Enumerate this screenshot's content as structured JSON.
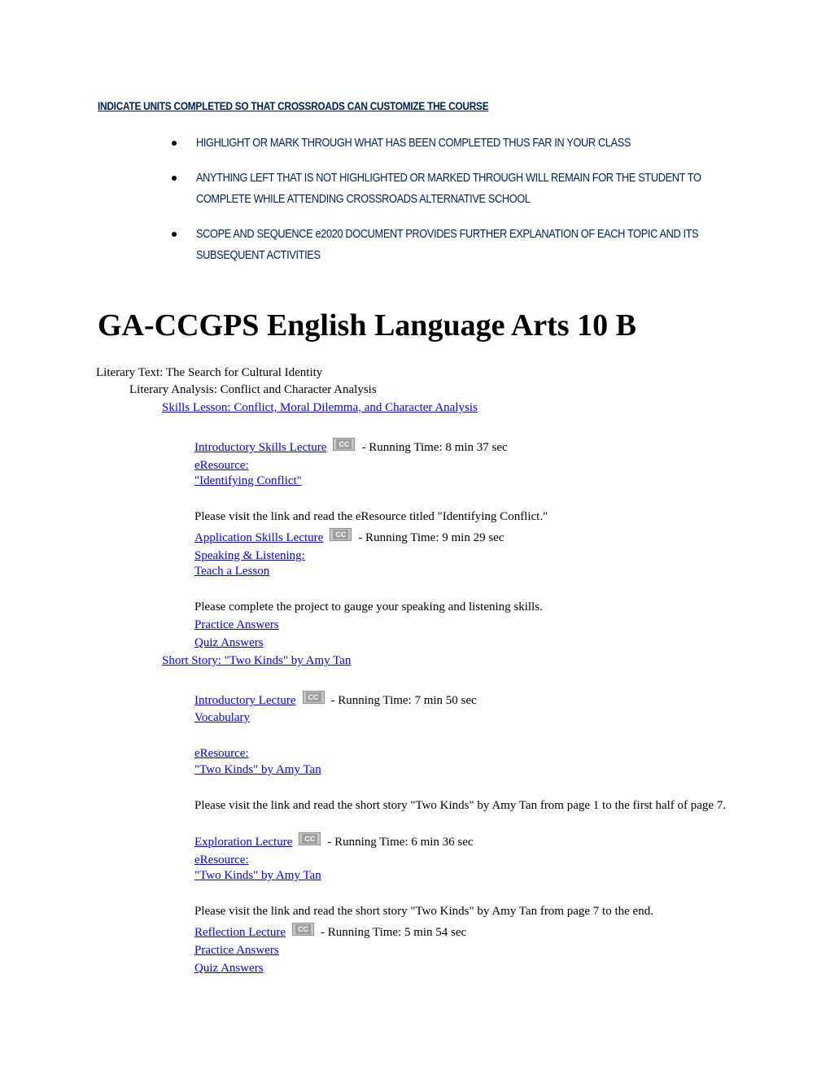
{
  "notice": {
    "heading": "INDICATE UNITS COMPLETED SO THAT CROSSROADS CAN CUSTOMIZE THE COURSE",
    "bullets": [
      "HIGHLIGHT OR MARK THROUGH WHAT HAS BEEN COMPLETED THUS FAR IN YOUR CLASS",
      "ANYTHING LEFT THAT IS NOT HIGHLIGHTED OR MARKED THROUGH WILL REMAIN FOR THE STUDENT TO COMPLETE WHILE ATTENDING CROSSROADS ALTERNATIVE SCHOOL",
      "SCOPE AND SEQUENCE e2020 DOCUMENT PROVIDES FURTHER EXPLANATION OF EACH TOPIC AND ITS SUBSEQUENT ACTIVITIES"
    ]
  },
  "course": {
    "title": "GA-CCGPS English Language Arts 10 B",
    "unit": "Literary Text: The Search for Cultural Identity",
    "topic": "Literary Analysis: Conflict and Character Analysis",
    "cc_label": "CC",
    "lessons": [
      {
        "title": "Skills Lesson: Conflict, Moral Dilemma, and Character Analysis",
        "items": {
          "intro_lecture": "Introductory Skills Lecture",
          "intro_time": "- Running Time: 8 min 37 sec",
          "eresource_label": "eResource:",
          "eresource_title": "\"Identifying Conflict\"",
          "instruction_1": "Please visit the link and read the eResource titled \"Identifying Conflict.\"",
          "app_lecture": "Application Skills Lecture",
          "app_time": "- Running Time: 9 min 29 sec",
          "speaking_label": "Speaking & Listening:",
          "speaking_title": "Teach a Lesson",
          "instruction_2": "Please complete the project to gauge your speaking and listening skills.",
          "practice": "Practice Answers",
          "quiz": "Quiz Answers"
        }
      },
      {
        "title": "Short Story: \"Two Kinds\" by Amy Tan",
        "items": {
          "intro_lecture": "Introductory Lecture",
          "intro_time": "- Running Time: 7 min 50 sec",
          "vocabulary": "Vocabulary",
          "eresource_label_1": "eResource:",
          "eresource_title_1": "\"Two Kinds\" by Amy Tan",
          "instruction_1": "Please visit the link and read the short story \"Two Kinds\" by Amy Tan from page 1 to the first half of page 7.",
          "exploration_lecture": "Exploration Lecture",
          "exploration_time": "- Running Time: 6 min 36 sec",
          "eresource_label_2": "eResource:",
          "eresource_title_2": "\"Two Kinds\" by Amy Tan",
          "instruction_2": "Please visit the link and read the short story \"Two Kinds\" by Amy Tan from page 7 to the end.",
          "reflection_lecture": "Reflection Lecture",
          "reflection_time": "- Running Time: 5 min 54 sec",
          "practice": "Practice Answers",
          "quiz": "Quiz Answers"
        }
      }
    ]
  }
}
